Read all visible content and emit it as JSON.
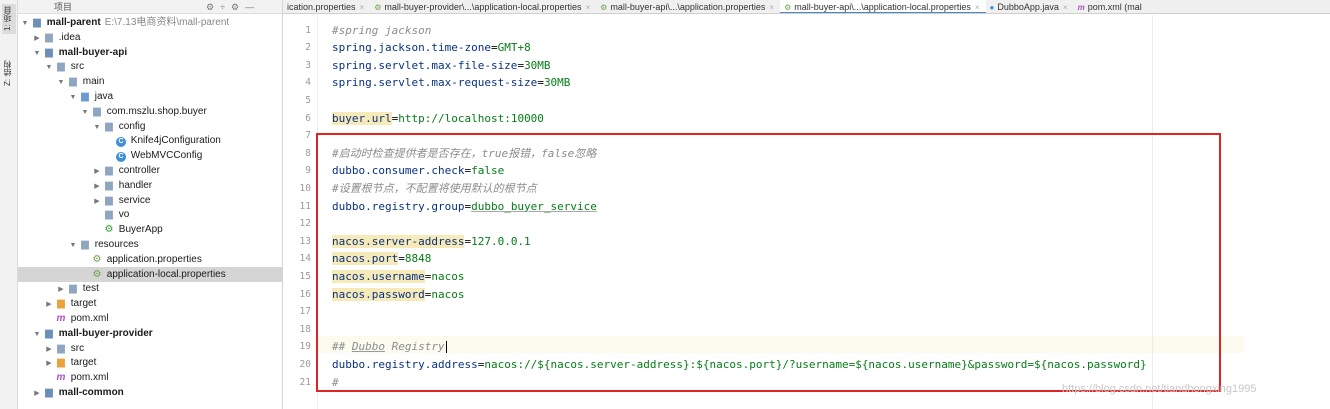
{
  "tool_strip": {
    "project_tab": "1: 项目",
    "structure_tab": "Z: 结构"
  },
  "project_panel": {
    "header_title": "项目",
    "tree": [
      {
        "label": "mall-parent",
        "path": "E:\\7.13电商资料\\mall-parent",
        "type": "module",
        "bold": true,
        "expanded": true,
        "indent": 0
      },
      {
        "label": ".idea",
        "type": "folder",
        "expanded": false,
        "indent": 1
      },
      {
        "label": "mall-buyer-api",
        "type": "module",
        "bold": true,
        "expanded": true,
        "indent": 1
      },
      {
        "label": "src",
        "type": "folder",
        "expanded": true,
        "indent": 2
      },
      {
        "label": "main",
        "type": "folder",
        "expanded": true,
        "indent": 3
      },
      {
        "label": "java",
        "type": "folder-blue",
        "expanded": true,
        "indent": 4
      },
      {
        "label": "com.mszlu.shop.buyer",
        "type": "folder",
        "expanded": true,
        "indent": 5
      },
      {
        "label": "config",
        "type": "folder",
        "expanded": true,
        "indent": 6
      },
      {
        "label": "Knife4jConfiguration",
        "type": "class",
        "indent": 7
      },
      {
        "label": "WebMVCConfig",
        "type": "class",
        "indent": 7
      },
      {
        "label": "controller",
        "type": "folder",
        "expanded": false,
        "indent": 6
      },
      {
        "label": "handler",
        "type": "folder",
        "expanded": false,
        "indent": 6
      },
      {
        "label": "service",
        "type": "folder",
        "expanded": false,
        "indent": 6
      },
      {
        "label": "vo",
        "type": "folder",
        "indent": 6
      },
      {
        "label": "BuyerApp",
        "type": "app",
        "indent": 6
      },
      {
        "label": "resources",
        "type": "folder",
        "expanded": true,
        "indent": 4
      },
      {
        "label": "application.properties",
        "type": "props",
        "indent": 5
      },
      {
        "label": "application-local.properties",
        "type": "props",
        "indent": 5,
        "selected": true
      },
      {
        "label": "test",
        "type": "folder",
        "expanded": false,
        "indent": 3
      },
      {
        "label": "target",
        "type": "folder-orange",
        "expanded": false,
        "indent": 2
      },
      {
        "label": "pom.xml",
        "type": "maven",
        "indent": 2
      },
      {
        "label": "mall-buyer-provider",
        "type": "module",
        "bold": true,
        "expanded": true,
        "indent": 1
      },
      {
        "label": "src",
        "type": "folder",
        "expanded": false,
        "indent": 2
      },
      {
        "label": "target",
        "type": "folder-orange",
        "expanded": false,
        "indent": 2
      },
      {
        "label": "pom.xml",
        "type": "maven",
        "indent": 2
      },
      {
        "label": "mall-common",
        "type": "module",
        "bold": true,
        "expanded": false,
        "indent": 1
      }
    ]
  },
  "tabs": [
    {
      "label": "ication.properties",
      "icon": "p",
      "active": false
    },
    {
      "label": "mall-buyer-provider\\...\\application-local.properties",
      "icon": "p",
      "active": false
    },
    {
      "label": "mall-buyer-api\\...\\application.properties",
      "icon": "p",
      "active": false
    },
    {
      "label": "mall-buyer-api\\...\\application-local.properties",
      "icon": "p",
      "active": true
    },
    {
      "label": "DubboApp.java",
      "icon": "j",
      "active": false
    },
    {
      "label": "pom.xml (mal",
      "icon": "m",
      "active": false
    }
  ],
  "editor": {
    "lines": [
      {
        "n": "1",
        "tokens": [
          {
            "t": "#spring jackson",
            "c": "cmt"
          }
        ]
      },
      {
        "n": "2",
        "tokens": [
          {
            "t": "spring.jackson.time-zone",
            "c": "key"
          },
          {
            "t": "=",
            "c": "sep"
          },
          {
            "t": "GMT+8",
            "c": "val"
          }
        ]
      },
      {
        "n": "3",
        "tokens": [
          {
            "t": "spring.servlet.max-file-size",
            "c": "key"
          },
          {
            "t": "=",
            "c": "sep"
          },
          {
            "t": "30MB",
            "c": "val"
          }
        ]
      },
      {
        "n": "4",
        "tokens": [
          {
            "t": "spring.servlet.max-request-size",
            "c": "key"
          },
          {
            "t": "=",
            "c": "sep"
          },
          {
            "t": "30MB",
            "c": "val"
          }
        ]
      },
      {
        "n": "5",
        "tokens": []
      },
      {
        "n": "6",
        "tokens": [
          {
            "t": "buyer.url",
            "c": "key hl"
          },
          {
            "t": "=",
            "c": "sep"
          },
          {
            "t": "http://localhost:10000",
            "c": "val"
          }
        ]
      },
      {
        "n": "7",
        "tokens": []
      },
      {
        "n": "8",
        "tokens": [
          {
            "t": "#启动时检查提供者是否存在，true报错，false忽略",
            "c": "cmt"
          }
        ]
      },
      {
        "n": "9",
        "tokens": [
          {
            "t": "dubbo.consumer.check",
            "c": "key"
          },
          {
            "t": "=",
            "c": "sep"
          },
          {
            "t": "false",
            "c": "val"
          }
        ]
      },
      {
        "n": "10",
        "tokens": [
          {
            "t": "#设置根节点，不配置将使用默认的根节点",
            "c": "cmt"
          }
        ]
      },
      {
        "n": "11",
        "tokens": [
          {
            "t": "dubbo.registry.group",
            "c": "key"
          },
          {
            "t": "=",
            "c": "sep"
          },
          {
            "t": "dubbo_buyer_service",
            "c": "val-u"
          }
        ]
      },
      {
        "n": "12",
        "tokens": []
      },
      {
        "n": "13",
        "tokens": [
          {
            "t": "nacos.server-address",
            "c": "key hl"
          },
          {
            "t": "=",
            "c": "sep"
          },
          {
            "t": "127.0.0.1",
            "c": "val"
          }
        ]
      },
      {
        "n": "14",
        "tokens": [
          {
            "t": "nacos.port",
            "c": "key hl"
          },
          {
            "t": "=",
            "c": "sep"
          },
          {
            "t": "8848",
            "c": "val"
          }
        ]
      },
      {
        "n": "15",
        "tokens": [
          {
            "t": "nacos.username",
            "c": "key hl"
          },
          {
            "t": "=",
            "c": "sep"
          },
          {
            "t": "nacos",
            "c": "val"
          }
        ]
      },
      {
        "n": "16",
        "tokens": [
          {
            "t": "nacos.password",
            "c": "key hl"
          },
          {
            "t": "=",
            "c": "sep"
          },
          {
            "t": "nacos",
            "c": "val"
          }
        ]
      },
      {
        "n": "17",
        "tokens": []
      },
      {
        "n": "18",
        "tokens": []
      },
      {
        "n": "19",
        "tokens": [
          {
            "t": "## ",
            "c": "cmt"
          },
          {
            "t": "Dubbo",
            "c": "cmt uln"
          },
          {
            "t": " Registry",
            "c": "cmt"
          }
        ],
        "caret": true
      },
      {
        "n": "20",
        "tokens": [
          {
            "t": "dubbo.registry.address",
            "c": "key"
          },
          {
            "t": "=",
            "c": "sep"
          },
          {
            "t": "nacos://${nacos.server-address}:${nacos.port}/?username=${nacos.username}&password=${nacos.password}",
            "c": "val"
          }
        ]
      },
      {
        "n": "21",
        "tokens": [
          {
            "t": "#",
            "c": "cmt"
          }
        ]
      }
    ]
  },
  "watermark": "https://blog.csdn.net/tiandhongxing1995"
}
